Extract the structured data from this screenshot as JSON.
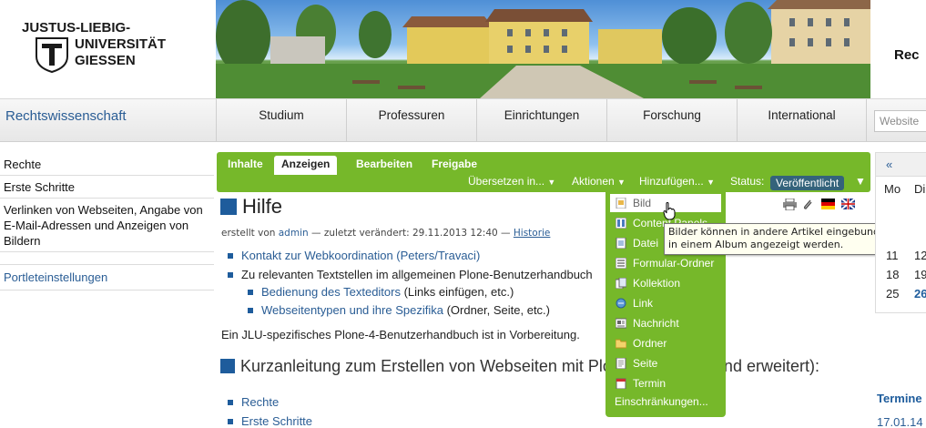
{
  "header": {
    "logo_lines": [
      "JUSTUS-LIEBIG-",
      "UNIVERSITÄT",
      "GIESSEN"
    ],
    "right_text": "Rec"
  },
  "site": {
    "name": "Rechtswissenschaft",
    "search_placeholder": "Website"
  },
  "main_nav": [
    "Studium",
    "Professuren",
    "Einrichtungen",
    "Forschung",
    "International"
  ],
  "left_nav": [
    "Rechte",
    "Erste Schritte",
    "Verlinken von Webseiten, Angabe von E-Mail-Adressen und Anzeigen von Bildern"
  ],
  "portlet_settings": "Portleteinstellungen",
  "content_views": [
    "Inhalte",
    "Anzeigen",
    "Bearbeiten",
    "Freigabe"
  ],
  "active_view": "Anzeigen",
  "content_actions": {
    "translate": "Übersetzen in...",
    "actions": "Aktionen",
    "add": "Hinzufügen...",
    "status_label": "Status:",
    "status_value": "Veröffentlicht",
    "arrow": "▼"
  },
  "page": {
    "title": "Hilfe",
    "byline_created": "erstellt von",
    "byline_author": "admin",
    "byline_modified": "— zuletzt verändert: 29.11.2013 12:40 —",
    "byline_history": "Historie",
    "link_1": "Kontakt zur Webkoordination (Peters/Travaci)",
    "text_2": "Zu relevanten Textstellen im allgemeinen Plone-Benutzerhandbuch",
    "sub_link_1": "Bedienung des Texteditors",
    "sub_text_1": " (Links einfügen, etc.)",
    "sub_link_2": "Webseitentypen und ihre Spezifika",
    "sub_text_2": " (Ordner, Seite, etc.)",
    "note": "Ein JLU-spezifisches Plone-4-Benutzerhandbuch ist in Vorbereitung.",
    "section_title": "Kurzanleitung zum Erstellen von Webseiten mit Plone 4 (wird laufend erweitert):",
    "section_link_1": "Rechte",
    "section_link_2": "Erste Schritte"
  },
  "add_menu": {
    "items": [
      {
        "label": "Bild",
        "icon": "image-icon"
      },
      {
        "label": "Content Panels",
        "icon": "content-panels-icon"
      },
      {
        "label": "Datei",
        "icon": "file-icon"
      },
      {
        "label": "Formular-Ordner",
        "icon": "form-folder-icon"
      },
      {
        "label": "Kollektion",
        "icon": "collection-icon"
      },
      {
        "label": "Link",
        "icon": "link-icon"
      },
      {
        "label": "Nachricht",
        "icon": "news-icon"
      },
      {
        "label": "Ordner",
        "icon": "folder-icon"
      },
      {
        "label": "Seite",
        "icon": "page-icon"
      },
      {
        "label": "Termin",
        "icon": "event-icon"
      }
    ],
    "more": "Einschränkungen..."
  },
  "tooltip": "Bilder können in andere Artikel eingebunden oder in einem Album angezeigt werden.",
  "calendar": {
    "prev": "«",
    "day_headers": [
      "Mo",
      "Di"
    ],
    "rows": [
      [
        "11",
        "12"
      ],
      [
        "18",
        "19"
      ],
      [
        "25",
        "26"
      ]
    ]
  },
  "events": {
    "title": "Termine",
    "date": "17.01.14"
  },
  "colors": {
    "accent_green": "#76b82a",
    "link_blue": "#2a5d95",
    "status_badge": "#34637b"
  }
}
